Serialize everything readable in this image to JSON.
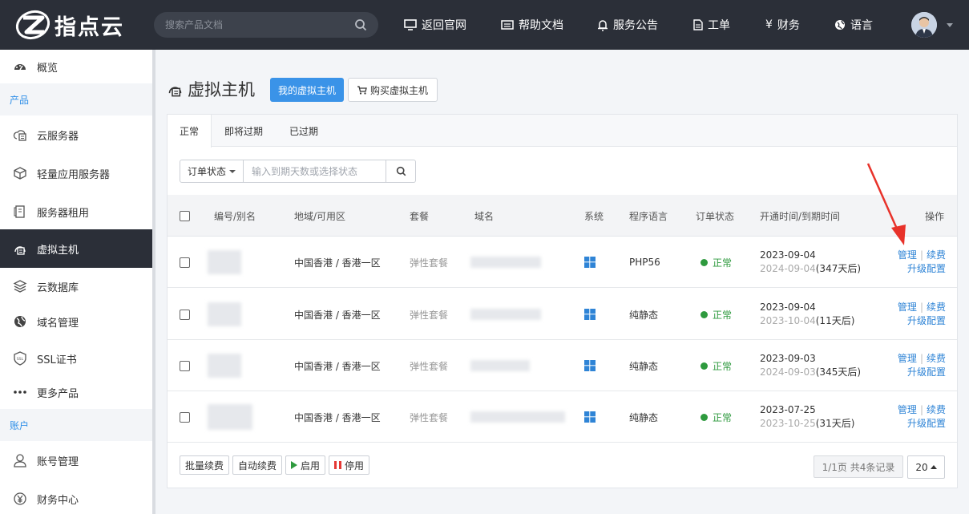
{
  "brand": {
    "name": "指点云"
  },
  "header": {
    "search_placeholder": "搜索产品文档",
    "nav": [
      {
        "label": "返回官网",
        "icon": "monitor-icon"
      },
      {
        "label": "帮助文档",
        "icon": "doc-icon"
      },
      {
        "label": "服务公告",
        "icon": "bell-icon"
      },
      {
        "label": "工单",
        "icon": "ticket-icon"
      },
      {
        "label": "财务",
        "icon": "yen-icon"
      },
      {
        "label": "语言",
        "icon": "globe-icon"
      }
    ]
  },
  "sidebar": {
    "items": [
      {
        "label": "概览",
        "icon": "dashboard-icon"
      },
      {
        "label": "产品",
        "group": true
      },
      {
        "label": "云服务器",
        "icon": "cloud-server-icon"
      },
      {
        "label": "轻量应用服务器",
        "icon": "cube-icon"
      },
      {
        "label": "服务器租用",
        "icon": "server-rack-icon"
      },
      {
        "label": "虚拟主机",
        "icon": "virtual-host-icon",
        "active": true
      },
      {
        "label": "云数据库",
        "icon": "database-icon"
      },
      {
        "label": "域名管理",
        "icon": "globe-icon"
      },
      {
        "label": "SSL证书",
        "icon": "ssl-shield-icon"
      },
      {
        "label": "更多产品",
        "icon": "more-dots-icon"
      },
      {
        "label": "账户",
        "group": true
      },
      {
        "label": "账号管理",
        "icon": "user-icon"
      },
      {
        "label": "财务中心",
        "icon": "yen-circle-icon"
      }
    ]
  },
  "main": {
    "title": "虚拟主机",
    "my_hosts_button": "我的虚拟主机",
    "buy_button": "购买虚拟主机",
    "tabs": [
      "正常",
      "即将过期",
      "已过期"
    ],
    "filter": {
      "status_label": "订单状态",
      "placeholder": "输入到期天数或选择状态"
    },
    "columns": [
      "编号/别名",
      "地域/可用区",
      "套餐",
      "域名",
      "系统",
      "程序语言",
      "订单状态",
      "开通时间/到期时间",
      "操作"
    ],
    "rows": [
      {
        "region": "中国香港 / 香港一区",
        "plan": "弹性套餐",
        "language": "PHP56",
        "status": "正常",
        "open_date": "2023-09-04",
        "expire_date": "2024-09-04",
        "remaining": "(347天后)"
      },
      {
        "region": "中国香港 / 香港一区",
        "plan": "弹性套餐",
        "language": "纯静态",
        "status": "正常",
        "open_date": "2023-09-04",
        "expire_date": "2023-10-04",
        "remaining": "(11天后)"
      },
      {
        "region": "中国香港 / 香港一区",
        "plan": "弹性套餐",
        "language": "纯静态",
        "status": "正常",
        "open_date": "2023-09-03",
        "expire_date": "2024-09-03",
        "remaining": "(345天后)"
      },
      {
        "region": "中国香港 / 香港一区",
        "plan": "弹性套餐",
        "language": "纯静态",
        "status": "正常",
        "open_date": "2023-07-25",
        "expire_date": "2023-10-25",
        "remaining": "(31天后)"
      }
    ],
    "actions": {
      "manage": "管理",
      "separator": "|",
      "renew": "续费",
      "upgrade": "升级配置"
    },
    "footer": {
      "batch_renew": "批量续费",
      "auto_renew": "自动续费",
      "enable": "启用",
      "disable": "停用",
      "page_info": "1/1页 共4条记录",
      "page_size": "20"
    }
  },
  "colors": {
    "topbar": "#2b2f38",
    "accent": "#3a93e8",
    "status_ok": "#2e9a3e",
    "link": "#2f84d6",
    "arrow": "#e8322a"
  }
}
